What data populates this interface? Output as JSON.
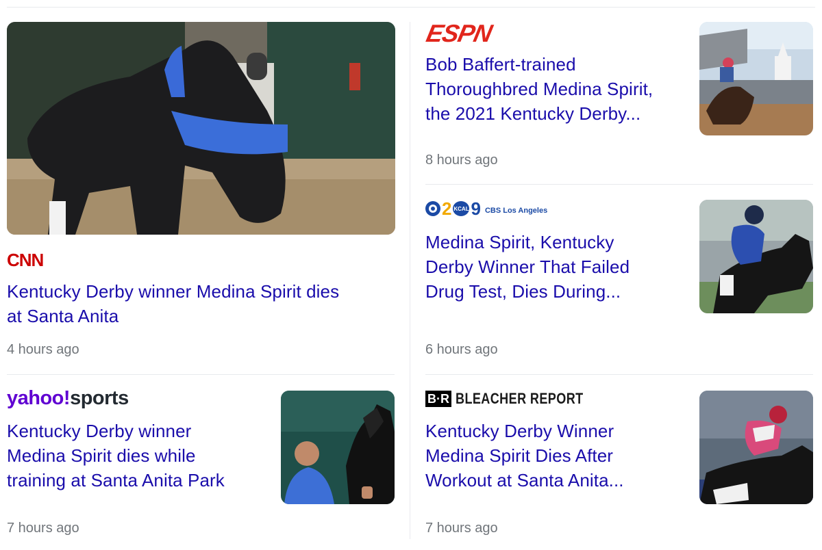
{
  "articles": [
    {
      "source": "CNN",
      "headline_line1": "Kentucky Derby winner Medina Spirit dies",
      "headline_line2": "at Santa Anita",
      "time": "4 hours ago",
      "image": "horse-with-blue-halter-photo"
    },
    {
      "source_part1": "yahoo!",
      "source_part2": "sports",
      "headline_line1": "Kentucky Derby winner",
      "headline_line2": "Medina Spirit dies while",
      "headline_line3": "training at Santa Anita Park",
      "time": "7 hours ago",
      "image": "trainer-with-horse-photo"
    },
    {
      "source": "ESPN",
      "headline_line1": "Bob Baffert-trained",
      "headline_line2": "Thoroughbred Medina Spirit,",
      "headline_line3": "the 2021 Kentucky Derby...",
      "time": "8 hours ago",
      "image": "derby-race-finish-photo"
    },
    {
      "source_num1": "2",
      "source_badge": "KCAL",
      "source_num2": "9",
      "source_name": "CBS Los Angeles",
      "headline_line1": "Medina Spirit, Kentucky",
      "headline_line2": "Derby Winner That Failed",
      "headline_line3": "Drug Test, Dies During...",
      "time": "6 hours ago",
      "image": "jockey-riding-horse-photo"
    },
    {
      "source_badge": "B·R",
      "source_name": "BLEACHER REPORT",
      "headline_line1": "Kentucky Derby Winner",
      "headline_line2": "Medina Spirit Dies After",
      "headline_line3": "Workout at Santa Anita...",
      "time": "7 hours ago",
      "image": "jockey-pink-silks-photo"
    }
  ],
  "colors": {
    "headline": "#1a0dab",
    "time": "#70757a",
    "divider": "#e8eaed"
  }
}
